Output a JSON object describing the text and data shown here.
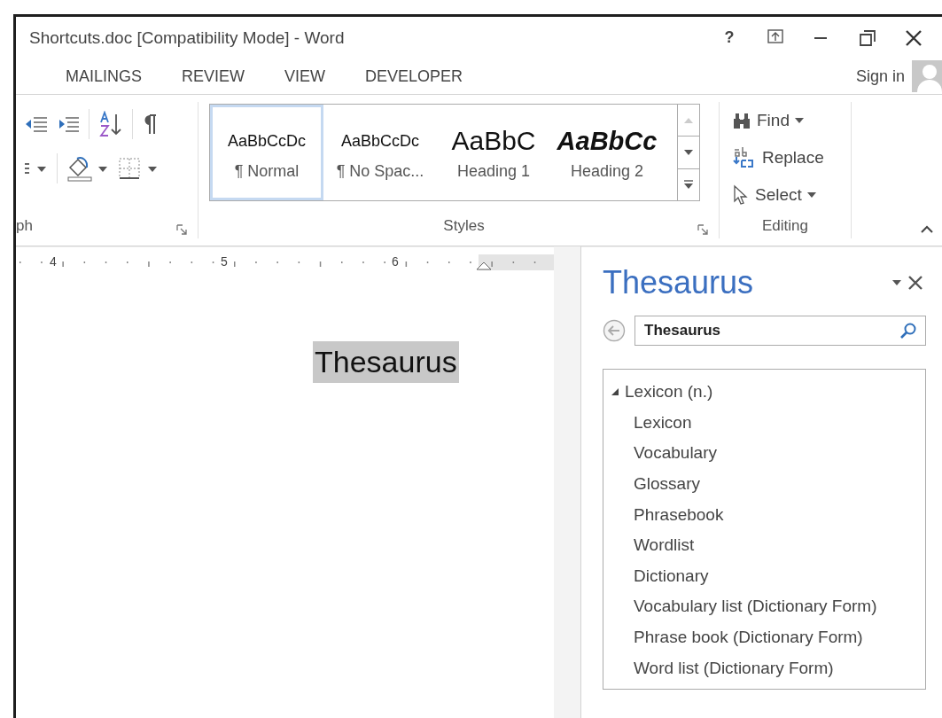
{
  "window": {
    "title": "Shortcuts.doc [Compatibility Mode] - Word",
    "help": "?"
  },
  "tabs": [
    {
      "label": "MAILINGS",
      "selected": false
    },
    {
      "label": "REVIEW",
      "selected": false
    },
    {
      "label": "VIEW",
      "selected": false
    },
    {
      "label": "DEVELOPER",
      "selected": false
    }
  ],
  "account": {
    "label": "Sign in"
  },
  "ribbon": {
    "paragraph_group": {
      "label": "ph"
    },
    "styles_group": {
      "label": "Styles",
      "styles": [
        {
          "preview": "AaBbCcDc",
          "name": "¶ Normal",
          "kind": "body",
          "selected": true
        },
        {
          "preview": "AaBbCcDc",
          "name": "¶ No Spac...",
          "kind": "body",
          "selected": false
        },
        {
          "preview": "AaBbC",
          "name": "Heading 1",
          "kind": "heading1",
          "selected": false
        },
        {
          "preview": "AaBbCc",
          "name": "Heading 2",
          "kind": "heading2",
          "selected": false
        }
      ]
    },
    "editing_group": {
      "label": "Editing",
      "commands": [
        {
          "label": "Find",
          "kind": "find",
          "dropdown": true
        },
        {
          "label": "Replace",
          "kind": "replace",
          "dropdown": false
        },
        {
          "label": "Select",
          "kind": "select",
          "dropdown": true
        }
      ]
    }
  },
  "ruler": {
    "numbers": [
      "4",
      "5",
      "6"
    ]
  },
  "document": {
    "text": "Thesaurus",
    "highlighted": true
  },
  "thesaurus_pane": {
    "title": "Thesaurus",
    "search": {
      "value": "Thesaurus"
    },
    "results": [
      {
        "label": "Lexicon (n.)",
        "expanded": true,
        "children": [
          {
            "label": "Lexicon"
          },
          {
            "label": "Vocabulary"
          },
          {
            "label": "Glossary"
          },
          {
            "label": "Phrasebook"
          },
          {
            "label": "Wordlist"
          },
          {
            "label": "Dictionary"
          },
          {
            "label": "Vocabulary list (Dictionary Form)"
          },
          {
            "label": "Phrase book (Dictionary Form)"
          },
          {
            "label": "Word list (Dictionary Form)"
          }
        ]
      }
    ]
  }
}
